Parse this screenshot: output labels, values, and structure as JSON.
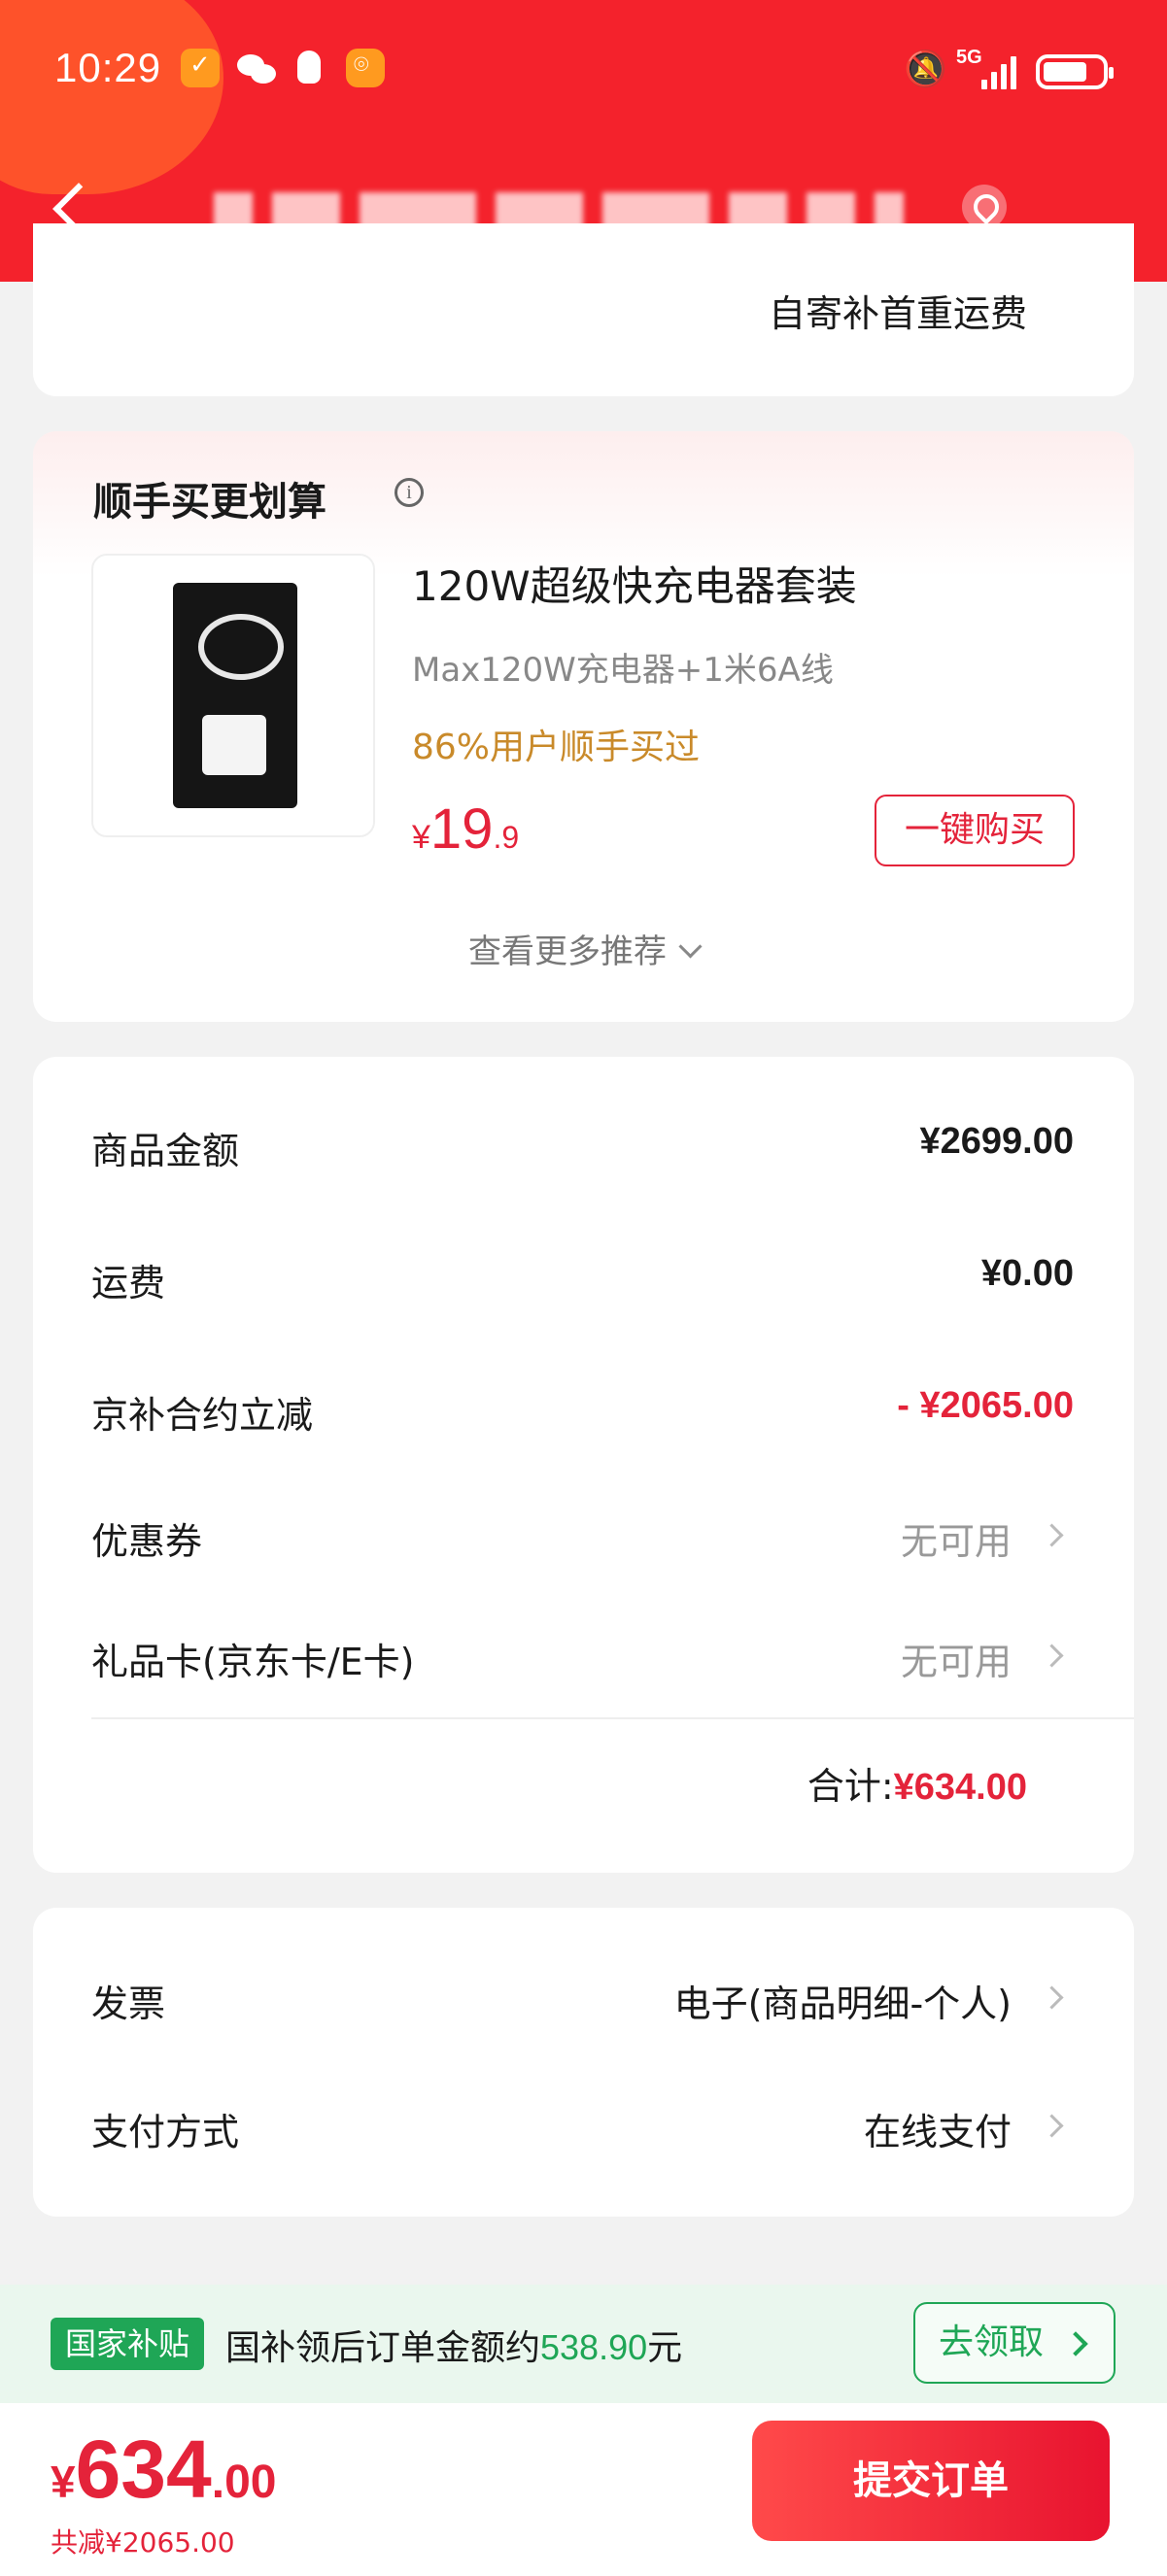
{
  "status_bar": {
    "time": "10:29",
    "network": "5G",
    "icons": [
      "shield-check-icon",
      "wechat-icon",
      "qq-icon",
      "app-icon",
      "mute-icon",
      "signal-icon",
      "battery-icon"
    ]
  },
  "header": {
    "back_icon": "chevron-left-icon",
    "location_icon": "location-icon",
    "accent_color": "#f4222c"
  },
  "top_card": {
    "self_send_text": "自寄补首重运费"
  },
  "recommend": {
    "title": "顺手买更划算",
    "product": {
      "name": "120W超级快充电器套装",
      "desc": "Max120W充电器+1米6A线",
      "buy_rate": "86%用户顺手买过",
      "price_currency": "¥",
      "price_int": "19",
      "price_dec": ".9",
      "buy_button": "一键购买"
    },
    "see_more": "查看更多推荐"
  },
  "summary": {
    "rows": [
      {
        "label": "商品金额",
        "value": "¥2699.00"
      },
      {
        "label": "运费",
        "value": "¥0.00"
      },
      {
        "label": "京补合约立减",
        "value": "- ¥2065.00"
      },
      {
        "label": "优惠券",
        "value": "无可用"
      },
      {
        "label": "礼品卡(京东卡/E卡)",
        "value": "无可用"
      }
    ],
    "total_label": "合计:",
    "total_value": "¥634.00"
  },
  "invoice": {
    "rows": [
      {
        "label": "发票",
        "value": "电子(商品明细-个人)"
      },
      {
        "label": "支付方式",
        "value": "在线支付"
      }
    ]
  },
  "subsidy": {
    "badge": "国家补贴",
    "text_prefix": "国补领后订单金额约",
    "amount": "538.90",
    "text_suffix": "元",
    "button": "去领取",
    "color": "#1fa656"
  },
  "bottom": {
    "price_currency": "¥",
    "price_int": "634",
    "price_dec": ".00",
    "saved": "共减¥2065.00",
    "submit": "提交订单"
  }
}
